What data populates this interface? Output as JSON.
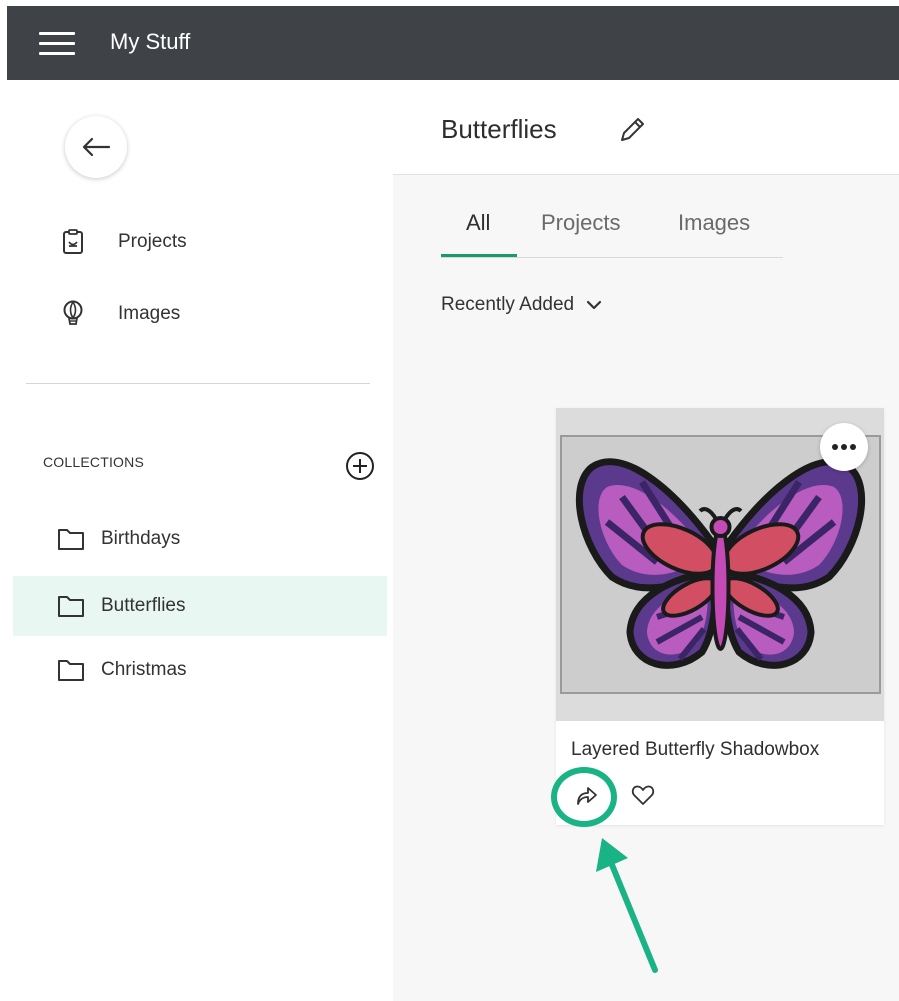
{
  "app": {
    "title": "My Stuff"
  },
  "sidebar": {
    "nav": [
      {
        "label": "Projects",
        "icon": "projects-icon"
      },
      {
        "label": "Images",
        "icon": "images-icon"
      }
    ],
    "collections_header": "COLLECTIONS",
    "collections": [
      {
        "label": "Birthdays",
        "active": false
      },
      {
        "label": "Butterflies",
        "active": true
      },
      {
        "label": "Christmas",
        "active": false
      }
    ]
  },
  "main": {
    "collection_title": "Butterflies",
    "tabs": [
      {
        "label": "All",
        "active": true
      },
      {
        "label": "Projects",
        "active": false
      },
      {
        "label": "Images",
        "active": false
      }
    ],
    "sort": {
      "label": "Recently Added"
    },
    "cards": [
      {
        "title": "Layered Butterfly Shadowbox",
        "image": "butterfly"
      }
    ]
  },
  "colors": {
    "topbar": "#3f4347",
    "accent": "#1a9a6c",
    "active_collection_bg": "#e9f7f2",
    "annotation": "#1ab385"
  }
}
